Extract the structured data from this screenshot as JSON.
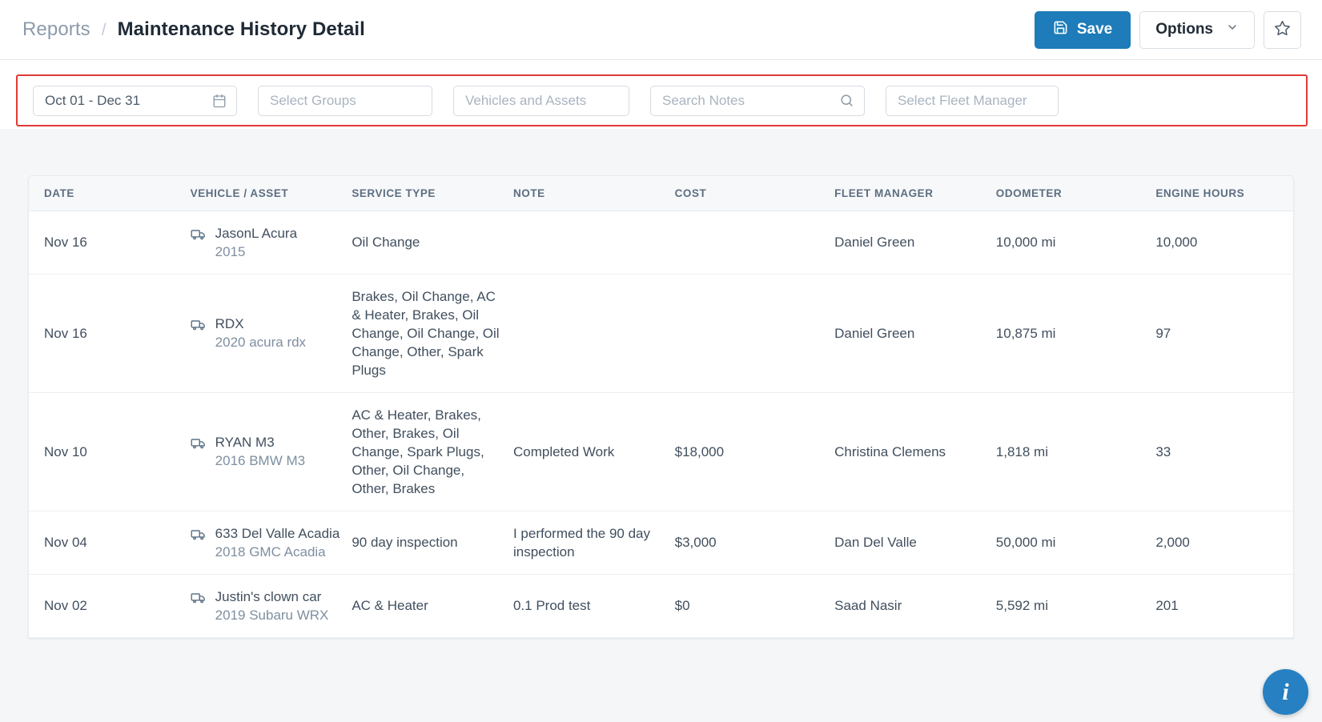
{
  "header": {
    "breadcrumb_parent": "Reports",
    "breadcrumb_separator": "/",
    "title": "Maintenance History Detail",
    "save_label": "Save",
    "options_label": "Options"
  },
  "filters": {
    "date_range_value": "Oct 01 - Dec 31",
    "groups_placeholder": "Select Groups",
    "vehicles_placeholder": "Vehicles and Assets",
    "notes_placeholder": "Search Notes",
    "fleet_manager_placeholder": "Select Fleet Manager",
    "highlight_color": "#e03a35"
  },
  "table": {
    "columns": [
      "DATE",
      "VEHICLE / ASSET",
      "SERVICE TYPE",
      "NOTE",
      "COST",
      "FLEET MANAGER",
      "ODOMETER",
      "ENGINE HOURS"
    ],
    "rows": [
      {
        "date": "Nov 16",
        "vehicle_name": "JasonL Acura",
        "vehicle_sub": "2015",
        "service_type": "Oil Change",
        "note": "",
        "cost": "",
        "fleet_manager": "Daniel Green",
        "odometer": "10,000 mi",
        "engine_hours": "10,000"
      },
      {
        "date": "Nov 16",
        "vehicle_name": "RDX",
        "vehicle_sub": "2020 acura rdx",
        "service_type": "Brakes, Oil Change, AC & Heater, Brakes, Oil Change, Oil Change, Oil Change, Other, Spark Plugs",
        "note": "",
        "cost": "",
        "fleet_manager": "Daniel Green",
        "odometer": "10,875 mi",
        "engine_hours": "97"
      },
      {
        "date": "Nov 10",
        "vehicle_name": "RYAN M3",
        "vehicle_sub": "2016 BMW M3",
        "service_type": "AC & Heater, Brakes, Other, Brakes, Oil Change, Spark Plugs, Other, Oil Change, Other, Brakes",
        "note": "Completed Work",
        "cost": "$18,000",
        "fleet_manager": "Christina Clemens",
        "odometer": "1,818 mi",
        "engine_hours": "33"
      },
      {
        "date": "Nov 04",
        "vehicle_name": "633 Del Valle Acadia",
        "vehicle_sub": "2018 GMC Acadia",
        "service_type": "90 day inspection",
        "note": "I performed the 90 day inspection",
        "cost": "$3,000",
        "fleet_manager": "Dan Del Valle",
        "odometer": "50,000 mi",
        "engine_hours": "2,000"
      },
      {
        "date": "Nov 02",
        "vehicle_name": "Justin's clown car",
        "vehicle_sub": "2019 Subaru WRX",
        "service_type": "AC & Heater",
        "note": "0.1 Prod test",
        "cost": "$0",
        "fleet_manager": "Saad Nasir",
        "odometer": "5,592 mi",
        "engine_hours": "201"
      }
    ]
  },
  "help": {
    "label": "i"
  }
}
